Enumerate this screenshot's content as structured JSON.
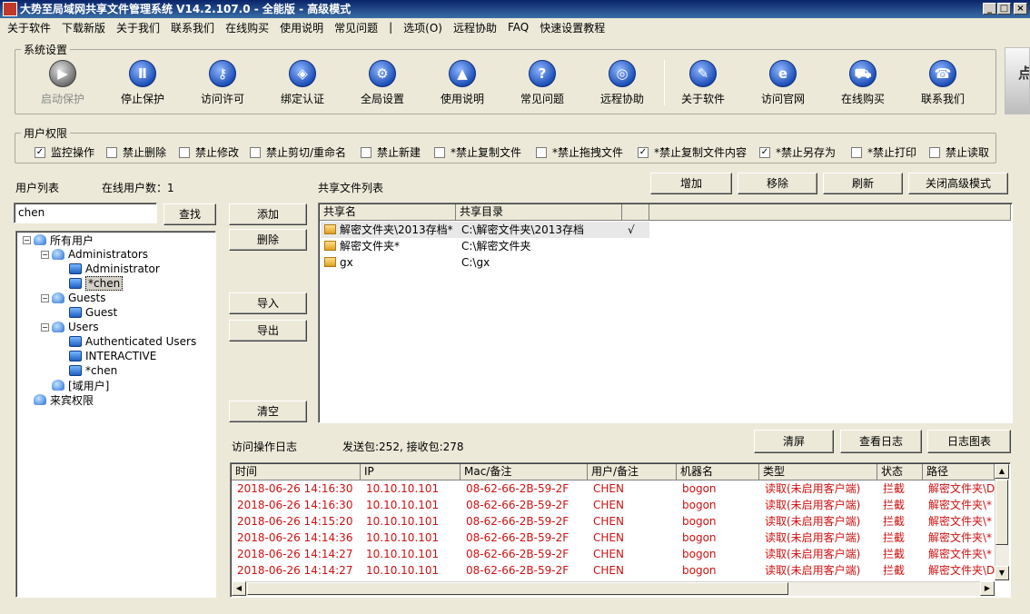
{
  "window": {
    "title": "大势至局域网共享文件管理系统 V14.2.107.0 - 全能版 - 高级模式",
    "min": "_",
    "max": "□",
    "close": "×"
  },
  "menu": [
    "关于软件",
    "下载新版",
    "关于我们",
    "联系我们",
    "在线购买",
    "使用说明",
    "常见问题",
    "|",
    "选项(O)",
    "远程协助",
    "FAQ",
    "快速设置教程"
  ],
  "system_settings": {
    "legend": "系统设置",
    "buttons": [
      {
        "label": "启动保护",
        "icon": "play-icon",
        "glyph": "▶",
        "disabled": true
      },
      {
        "label": "停止保护",
        "icon": "pause-icon",
        "glyph": "Ⅱ",
        "disabled": false
      },
      {
        "label": "访问许可",
        "icon": "key-icon",
        "glyph": "⚷",
        "disabled": false
      },
      {
        "label": "绑定认证",
        "icon": "shield-icon",
        "glyph": "◈",
        "disabled": false
      },
      {
        "label": "全局设置",
        "icon": "gear-icon",
        "glyph": "⚙",
        "disabled": false
      },
      {
        "label": "使用说明",
        "icon": "graduation-cap-icon",
        "glyph": "▲",
        "disabled": false
      },
      {
        "label": "常见问题",
        "icon": "question-icon",
        "glyph": "?",
        "disabled": false
      },
      {
        "label": "远程协助",
        "icon": "globe-icon",
        "glyph": "◎",
        "disabled": false
      },
      {
        "label": "关于软件",
        "icon": "document-icon",
        "glyph": "✎",
        "disabled": false
      },
      {
        "label": "访问官网",
        "icon": "ie-icon",
        "glyph": "e",
        "disabled": false
      },
      {
        "label": "在线购买",
        "icon": "cart-icon",
        "glyph": "⛟",
        "disabled": false
      },
      {
        "label": "联系我们",
        "icon": "phone-icon",
        "glyph": "☎",
        "disabled": false
      }
    ],
    "side_image_text": "点"
  },
  "permissions": {
    "legend": "用户权限",
    "items": [
      {
        "label": "监控操作",
        "checked": true
      },
      {
        "label": "禁止删除",
        "checked": false
      },
      {
        "label": "禁止修改",
        "checked": false
      },
      {
        "label": "禁止剪切/重命名",
        "checked": false
      },
      {
        "label": "禁止新建",
        "checked": false
      },
      {
        "label": "*禁止复制文件",
        "checked": false
      },
      {
        "label": "*禁止拖拽文件",
        "checked": false
      },
      {
        "label": "*禁止复制文件内容",
        "checked": true
      },
      {
        "label": "*禁止另存为",
        "checked": true
      },
      {
        "label": "*禁止打印",
        "checked": false
      },
      {
        "label": "禁止读取",
        "checked": false
      }
    ],
    "check_mark": "✓"
  },
  "users": {
    "label": "用户列表",
    "online_label": "在线用户数：1",
    "search_value": "chen",
    "search_button": "查找",
    "tree": [
      {
        "label": "所有用户",
        "type": "group",
        "exp": "−"
      },
      {
        "label": "Administrators",
        "type": "group",
        "exp": "−"
      },
      {
        "label": "Administrator",
        "type": "user",
        "exp": ""
      },
      {
        "label": "*chen",
        "type": "user",
        "exp": "",
        "selected": true
      },
      {
        "label": "Guests",
        "type": "group",
        "exp": "−"
      },
      {
        "label": "Guest",
        "type": "user",
        "exp": ""
      },
      {
        "label": "Users",
        "type": "group",
        "exp": "−"
      },
      {
        "label": "Authenticated Users",
        "type": "user",
        "exp": ""
      },
      {
        "label": "INTERACTIVE",
        "type": "user",
        "exp": ""
      },
      {
        "label": "*chen",
        "type": "user",
        "exp": ""
      },
      {
        "label": "[域用户]",
        "type": "group",
        "exp": ""
      },
      {
        "label": "来宾权限",
        "type": "group",
        "exp": ""
      }
    ]
  },
  "middle_buttons": {
    "add": "添加",
    "delete": "删除",
    "import": "导入",
    "export": "导出",
    "clear": "清空"
  },
  "shares": {
    "label": "共享文件列表",
    "buttons": {
      "add": "增加",
      "remove": "移除",
      "refresh": "刷新",
      "close_advanced": "关闭高级模式"
    },
    "columns": [
      "共享名",
      "共享目录",
      ""
    ],
    "rows": [
      {
        "name": "解密文件夹\\2013存档*",
        "path": "C:\\解密文件夹\\2013存档",
        "flag": "√"
      },
      {
        "name": "解密文件夹*",
        "path": "C:\\解密文件夹",
        "flag": ""
      },
      {
        "name": "gx",
        "path": "C:\\gx",
        "flag": ""
      }
    ]
  },
  "log": {
    "label": "访问操作日志",
    "packets": "发送包:252, 接收包:278",
    "buttons": {
      "clear": "清屏",
      "view": "查看日志",
      "chart": "日志图表"
    },
    "columns": [
      "时间",
      "IP",
      "Mac/备注",
      "用户/备注",
      "机器名",
      "类型",
      "状态",
      "路径"
    ],
    "rows": [
      [
        "2018-06-26 14:16:30",
        "10.10.10.101",
        "08-62-66-2B-59-2F",
        "CHEN",
        "bogon",
        "读取(未启用客户端)",
        "拦截",
        "解密文件夹\\DI"
      ],
      [
        "2018-06-26 14:16:30",
        "10.10.10.101",
        "08-62-66-2B-59-2F",
        "CHEN",
        "bogon",
        "读取(未启用客户端)",
        "拦截",
        "解密文件夹\\*"
      ],
      [
        "2018-06-26 14:15:20",
        "10.10.10.101",
        "08-62-66-2B-59-2F",
        "CHEN",
        "bogon",
        "读取(未启用客户端)",
        "拦截",
        "解密文件夹\\*"
      ],
      [
        "2018-06-26 14:14:36",
        "10.10.10.101",
        "08-62-66-2B-59-2F",
        "CHEN",
        "bogon",
        "读取(未启用客户端)",
        "拦截",
        "解密文件夹\\*"
      ],
      [
        "2018-06-26 14:14:27",
        "10.10.10.101",
        "08-62-66-2B-59-2F",
        "CHEN",
        "bogon",
        "读取(未启用客户端)",
        "拦截",
        "解密文件夹\\*"
      ],
      [
        "2018-06-26 14:14:27",
        "10.10.10.101",
        "08-62-66-2B-59-2F",
        "CHEN",
        "bogon",
        "读取(未启用客户端)",
        "拦截",
        "解密文件夹\\DI"
      ]
    ]
  },
  "colors": {
    "log_red": "#d01010",
    "title_blue": "#0a246a"
  }
}
